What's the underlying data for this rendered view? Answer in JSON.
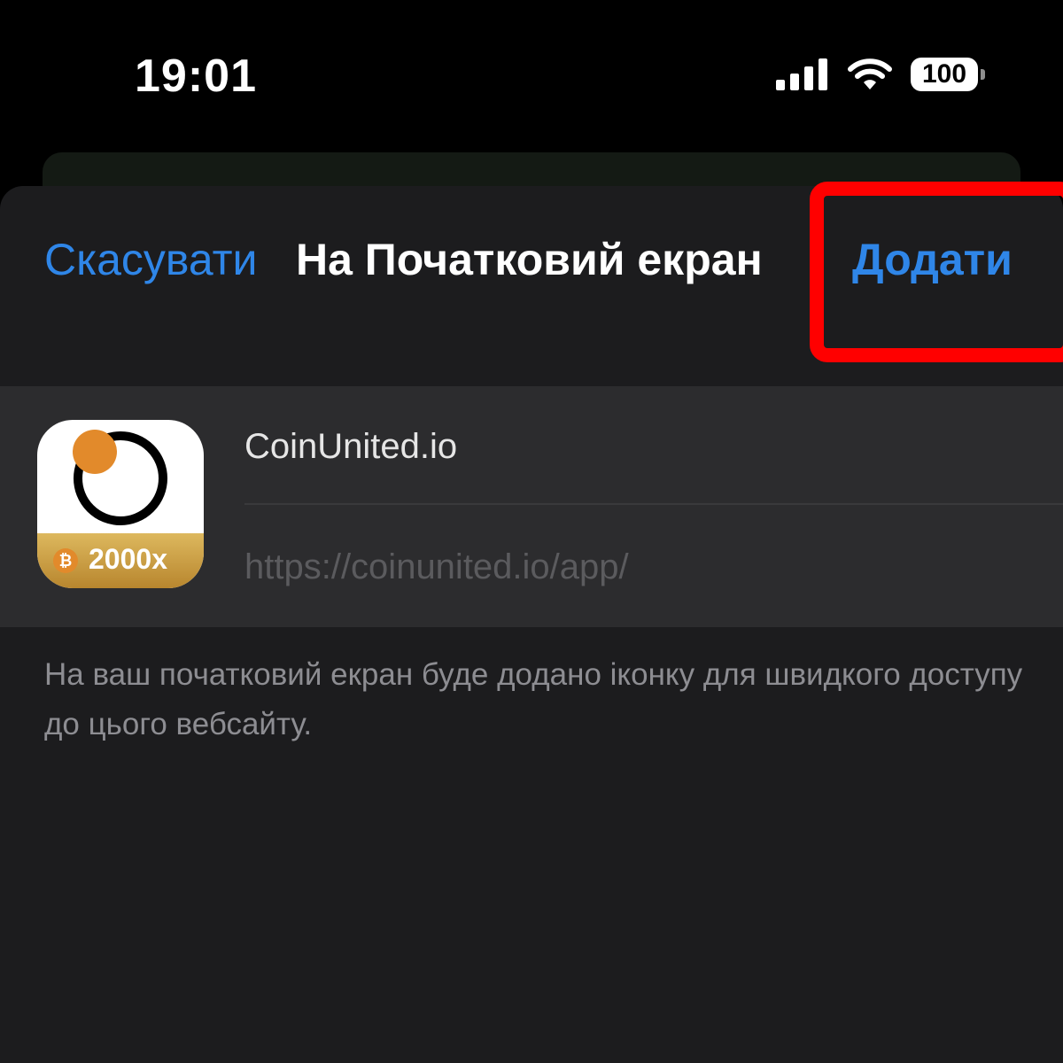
{
  "status_bar": {
    "time": "19:01",
    "battery_level": "100",
    "icons": [
      "signal-icon",
      "wifi-icon",
      "battery-icon"
    ]
  },
  "header": {
    "cancel_label": "Скасувати",
    "title": "На Початковий екран",
    "add_label": "Додати"
  },
  "app": {
    "name": "CoinUnited.io",
    "url": "https://coinunited.io/app/",
    "icon_badge_symbol": "₿",
    "icon_badge_text": "2000x"
  },
  "note": "На ваш початковий екран буде додано іконку для швидкого доступу до цього вебсайту.",
  "colors": {
    "accent": "#2f86e8",
    "highlight": "#ff0000",
    "background": "#1c1c1e",
    "card": "#2c2c2e",
    "icon_orange": "#e28a2b",
    "icon_gold": "#c9a24a"
  }
}
